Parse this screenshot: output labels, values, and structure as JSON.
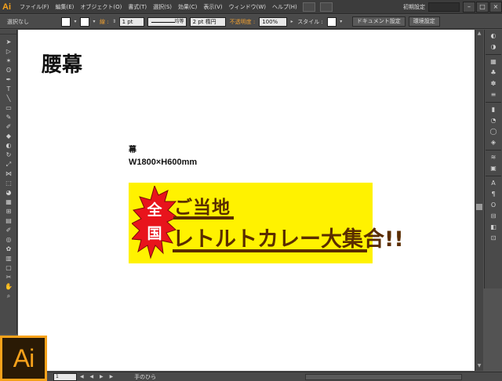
{
  "app": {
    "logo": "Ai",
    "menus": [
      "ファイル(F)",
      "編集(E)",
      "オブジェクト(O)",
      "書式(T)",
      "選択(S)",
      "効果(C)",
      "表示(V)",
      "ウィンドウ(W)",
      "ヘルプ(H)"
    ],
    "workspace": "初期設定",
    "window_buttons": [
      "–",
      "□",
      "×"
    ]
  },
  "controlbar": {
    "selection": "選択なし",
    "stroke_label": "線 :",
    "stroke_weight": "1 pt",
    "stroke_profile": "均等",
    "brush": "2 pt 楕円",
    "opacity_label": "不透明度 :",
    "opacity": "100%",
    "style_label": "スタイル :",
    "doc_setup": "ドキュメント設定",
    "prefs": "環境設定"
  },
  "tools": {
    "icons": [
      "selection-icon",
      "direct-selection-icon",
      "magic-wand-icon",
      "lasso-icon",
      "pen-icon",
      "type-icon",
      "line-icon",
      "rectangle-icon",
      "paintbrush-icon",
      "pencil-icon",
      "blob-brush-icon",
      "eraser-icon",
      "rotate-icon",
      "scale-icon",
      "width-icon",
      "free-transform-icon",
      "shape-builder-icon",
      "perspective-icon",
      "mesh-icon",
      "gradient-icon",
      "eyedropper-icon",
      "blend-icon",
      "symbol-sprayer-icon",
      "graph-icon",
      "artboard-icon",
      "slice-icon",
      "hand-icon",
      "zoom-icon"
    ],
    "glyphs": [
      "➤",
      "▷",
      "✶",
      "ʘ",
      "✒",
      "T",
      "╲",
      "▭",
      "✎",
      "✐",
      "◆",
      "◐",
      "↻",
      "⤢",
      "⋈",
      "⬚",
      "◕",
      "▦",
      "⊞",
      "▤",
      "✐",
      "◎",
      "✿",
      "▥",
      "▢",
      "✂",
      "✋",
      "⌕"
    ]
  },
  "rightpanel": {
    "icons": [
      "color-icon",
      "color-guide-icon",
      "swatches-icon",
      "brushes-icon",
      "symbols-icon",
      "stroke-icon",
      "gradient-icon",
      "transparency-icon",
      "appearance-icon",
      "graphic-styles-icon",
      "layers-icon",
      "artboards-icon",
      "character-icon",
      "paragraph-icon",
      "opentype-icon",
      "align-icon",
      "pathfinder-icon",
      "transform-icon"
    ],
    "glyphs": [
      "◐",
      "◑",
      "▦",
      "♣",
      "✽",
      "≡",
      "▮",
      "◔",
      "◯",
      "◈",
      "≋",
      "▣",
      "A",
      "¶",
      "O",
      "⊟",
      "◧",
      "⊡"
    ]
  },
  "document": {
    "heading": "腰幕",
    "spec_label": "幕",
    "spec_size": "W1800×H600mm",
    "banner": {
      "burst_top": "全",
      "burst_bottom": "国",
      "title": "ご当地",
      "main": "レトルトカレー大集合!!",
      "background_color": "#fff200",
      "text_color": "#5a2d00",
      "burst_color": "#e8141c"
    }
  },
  "statusbar": {
    "zoom": "1",
    "nav": "◀ ◀ ▶ ▶",
    "tool_hint": "手のひら"
  }
}
